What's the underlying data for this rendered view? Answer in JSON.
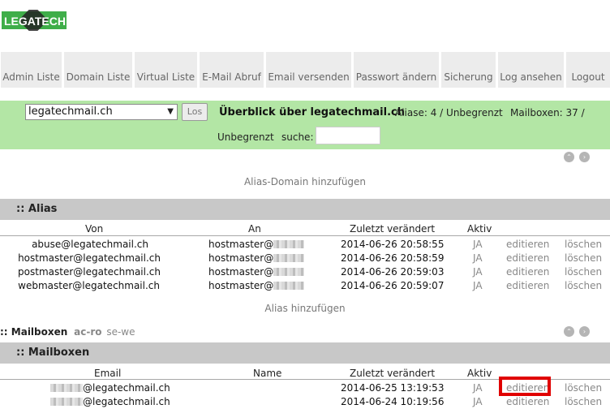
{
  "logo": {
    "text": "LEGATECH"
  },
  "nav": [
    {
      "label": "Admin Liste"
    },
    {
      "label": "Domain Liste"
    },
    {
      "label": "Virtual Liste"
    },
    {
      "label": "E-Mail Abruf"
    },
    {
      "label": "Email versenden"
    },
    {
      "label": "Passwort ändern"
    },
    {
      "label": "Sicherung"
    },
    {
      "label": "Log ansehen"
    },
    {
      "label": "Logout"
    }
  ],
  "overview": {
    "domain_selected": "legatechmail.ch",
    "los_label": "Los",
    "title": "Überblick über legatechmail.ch",
    "aliases_text": "Aliase: 4 / Unbegrenzt",
    "mailboxes_text": "Mailboxen: 37 /",
    "unlimited_text": "Unbegrenzt",
    "search_label": "suche:"
  },
  "pager_prev_glyph": "⌃",
  "pager_next_glyph": "›",
  "alias_domain_link": "Alias-Domain hinzufügen",
  "alias_section": {
    "title": ":: Alias",
    "headers": {
      "from": "Von",
      "to": "An",
      "modified": "Zuletzt verändert",
      "active": "Aktiv"
    },
    "rows": [
      {
        "from": "abuse@legatechmail.ch",
        "to": "hostmaster@",
        "modified": "2014-06-26 20:58:55",
        "active": "JA",
        "edit": "editieren",
        "delete": "löschen"
      },
      {
        "from": "hostmaster@legatechmail.ch",
        "to": "hostmaster@",
        "modified": "2014-06-26 20:58:59",
        "active": "JA",
        "edit": "editieren",
        "delete": "löschen"
      },
      {
        "from": "postmaster@legatechmail.ch",
        "to": "hostmaster@",
        "modified": "2014-06-26 20:59:03",
        "active": "JA",
        "edit": "editieren",
        "delete": "löschen"
      },
      {
        "from": "webmaster@legatechmail.ch",
        "to": "hostmaster@",
        "modified": "2014-06-26 20:59:07",
        "active": "JA",
        "edit": "editieren",
        "delete": "löschen"
      }
    ],
    "add_link": "Alias hinzufügen"
  },
  "mailbox_filter": {
    "label": ":: Mailboxen",
    "range1": "ac-ro",
    "range2": "se-we"
  },
  "mailbox_section": {
    "title": ":: Mailboxen",
    "headers": {
      "email": "Email",
      "name": "Name",
      "modified": "Zuletzt verändert",
      "active": "Aktiv"
    },
    "rows": [
      {
        "email": "@legatechmail.ch",
        "name": "",
        "modified": "2014-06-25 13:19:53",
        "active": "JA",
        "edit": "editieren",
        "delete": "löschen"
      },
      {
        "email": "@legatechmail.ch",
        "name": "",
        "modified": "2014-06-24 10:19:56",
        "active": "JA",
        "edit": "editieren",
        "delete": "löschen"
      }
    ]
  },
  "colors": {
    "overview_bg": "#b3e6a5",
    "section_bg": "#c8c8c8",
    "nav_bg": "#ececec",
    "highlight": "#e00000"
  }
}
